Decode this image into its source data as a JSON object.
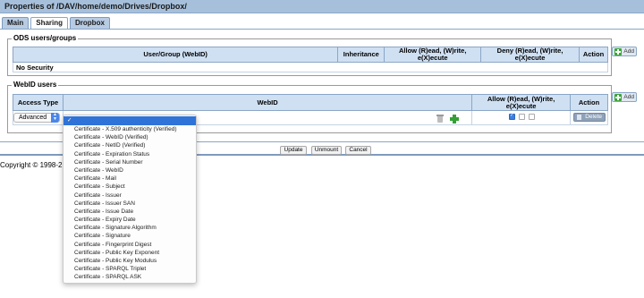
{
  "window": {
    "title": "Properties of /DAV/home/demo/Drives/Dropbox/"
  },
  "tabs": [
    {
      "label": "Main",
      "active": false
    },
    {
      "label": "Sharing",
      "active": true
    },
    {
      "label": "Dropbox",
      "active": false
    }
  ],
  "ods": {
    "legend": "ODS users/groups",
    "headers": {
      "user_group": "User/Group (WebID)",
      "inheritance": "Inheritance",
      "allow": "Allow (R)ead, (W)rite, e(X)ecute",
      "deny": "Deny (R)ead, (W)rite, e(X)ecute",
      "action": "Action"
    },
    "row_text": "No Security",
    "add_label": "Add"
  },
  "webid": {
    "legend": "WebID users",
    "headers": {
      "access_type": "Access Type",
      "webid": "WebID",
      "allow": "Allow (R)ead, (W)rite, e(X)ecute",
      "action": "Action"
    },
    "access_type_value": "Advanced",
    "allow_read": true,
    "allow_write": false,
    "allow_execute": false,
    "delete_label": "Delete",
    "add_label": "Add"
  },
  "buttons": {
    "update": "Update",
    "unmount": "Unmount",
    "cancel": "Cancel"
  },
  "copyright": "Copyright © 1998-2",
  "dropdown": {
    "selected_mark": "✓",
    "options": [
      "Certificate - X.509 authenticity (Verified)",
      "Certificate - WebID (Verified)",
      "Certificate - NetID (Verified)",
      "Certificate - Expiration Status",
      "Certificate - Serial Number",
      "Certificate - WebID",
      "Certificate - Mail",
      "Certificate - Subject",
      "Certificate - Issuer",
      "Certificate - Issuer SAN",
      "Certificate - Issue Date",
      "Certificate - Expiry Date",
      "Certificate - Signature Algorithm",
      "Certificate - Signature",
      "Certificate - Fingerprint Digest",
      "Certificate - Public Key Exponent",
      "Certificate - Public Key Modulus",
      "Certificate - SPARQL Triplet",
      "Certificate - SPARQL ASK"
    ]
  }
}
